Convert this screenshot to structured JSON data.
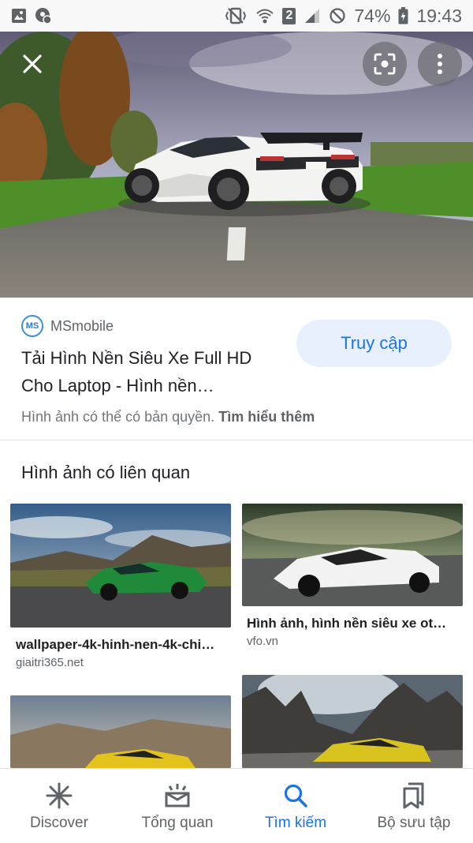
{
  "status_bar": {
    "battery": "74%",
    "time": "19:43",
    "sim": "2",
    "icons": [
      "image-icon",
      "location-icon",
      "vibrate-icon",
      "wifi-icon",
      "signal-icon",
      "do-not-disturb-icon",
      "battery-icon"
    ]
  },
  "hero": {
    "icons": {
      "close": "close-icon",
      "lens": "lens-icon",
      "more": "more-vert-icon"
    }
  },
  "result": {
    "source_logo": "MS",
    "source_name": "MSmobile",
    "title": "Tải Hình Nền Siêu Xe Full HD Cho Laptop - Hình nền…",
    "visit_label": "Truy cập",
    "copyright_text": "Hình ảnh có thể có bản quyền.",
    "learn_more": "Tìm hiểu thêm"
  },
  "related": {
    "heading": "Hình ảnh có liên quan",
    "items": [
      {
        "title": "wallpaper-4k-hinh-nen-4k-chi…",
        "site": "giaitri365.net",
        "car_color": "#1f8a3a"
      },
      {
        "title": "Hình ảnh, hình nền siêu xe ot…",
        "site": "vfo.vn",
        "car_color": "#f2f2f2"
      },
      {
        "car_color": "#e3c21c"
      },
      {
        "car_color": "#d9c41f"
      }
    ]
  },
  "bottom_nav": {
    "active": "search",
    "items": [
      {
        "label": "Discover",
        "icon": "asterisk-icon"
      },
      {
        "label": "Tổng quan",
        "icon": "updates-icon"
      },
      {
        "label": "Tìm kiếm",
        "icon": "search-icon"
      },
      {
        "label": "Bộ sưu tập",
        "icon": "collections-icon"
      }
    ]
  },
  "colors": {
    "accent": "#1a73e8",
    "visit_bg": "#e8f0fe"
  }
}
